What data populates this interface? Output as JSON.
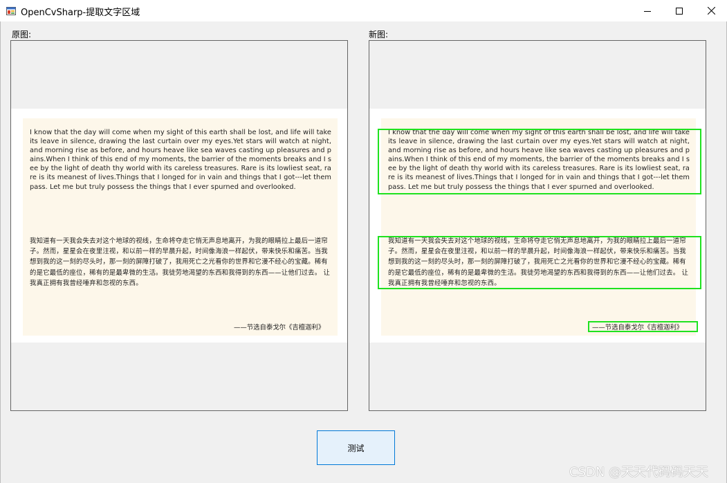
{
  "window": {
    "title": "OpenCvSharp-提取文字区域",
    "icons": {
      "app": "window-app-icon",
      "minimize": "minimize-icon",
      "maximize": "maximize-icon",
      "close": "close-icon"
    }
  },
  "labels": {
    "original": "原图:",
    "new": "新图:"
  },
  "document": {
    "english": "I know that the day will come when my sight of this earth shall be lost, and life will take its leave in silence, drawing the last curtain over my eyes.Yet stars will watch at night, and morning rise as before, and hours heave like sea waves casting up pleasures and pains.When I think of this end of my moments, the barrier of the moments breaks and I see by the light of death thy world with its careless treasures. Rare is its lowliest seat, rare is its meanest of lives.Things that I longed for in vain and things that I got---let them pass. Let me but truly possess the things that I ever spurned and overlooked.",
    "chinese": "我知道有一天我会失去对这个地球的视线，生命将夺走它悄无声息地离开，为我的眼睛拉上最后一道帘子。然而，星星会在夜里注视，和以前一样的早晨升起，时间像海浪一样起伏，带来快乐和痛苦。当我想到我的这一刻的尽头时，那一刻的屏障打破了，我用死亡之光看你的世界和它漫不经心的宝藏。稀有的是它最低的座位，稀有的是最卑微的生活。我徒劳地渴望的东西和我得到的东西——让他们过去。 让我真正拥有我曾经唾弃和忽视的东西。",
    "signature": "——节选自泰戈尔《吉檀迦利》"
  },
  "colors": {
    "detection_box": "#1ee21e",
    "paper": "#fdf7ea",
    "button_bg": "#e5f1fb",
    "button_border": "#0078d7"
  },
  "button": {
    "test_label": "测试"
  },
  "watermark": "CSDN @天天代码码天天"
}
